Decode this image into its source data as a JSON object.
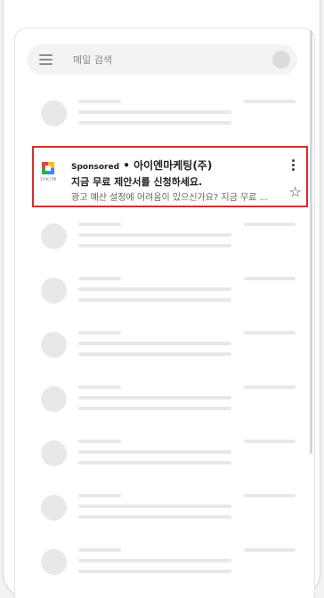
{
  "search": {
    "placeholder": "메일 검색"
  },
  "ad": {
    "sponsored_label": "Sponsored",
    "separator": " • ",
    "sender": "아이엔마케팅(주)",
    "subject": "지금 무료 제안서를 신청하세요.",
    "snippet": "광고 예산 설정에 어려움이 있으신가요? 지금 무료 제안서를 신청하세요.",
    "logo_caption": "고급 광고 전문",
    "logo_colors": [
      "#ea4335",
      "#fbbc05",
      "#34a853",
      "#4285f4"
    ]
  },
  "colors": {
    "highlight_border": "#d32f2f",
    "placeholder": "#e8e8e8"
  }
}
